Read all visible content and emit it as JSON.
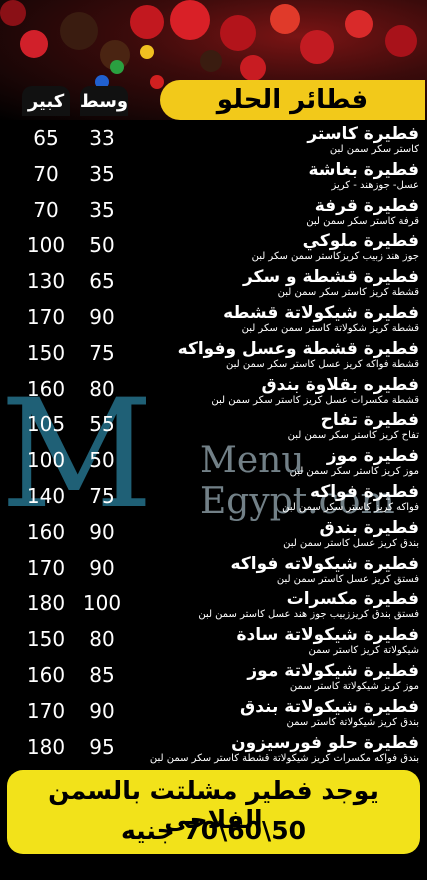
{
  "header": {
    "title": "فطائر الحلو",
    "col_large": "كبير",
    "col_medium": "وسط"
  },
  "watermark": {
    "logo_text": "Menu Egypt.com"
  },
  "items": [
    {
      "name": "فطيرة كاستر",
      "desc": "كاستر سكر سمن لبن",
      "medium": "33",
      "large": "65"
    },
    {
      "name": "فطيرة بغاشة",
      "desc": "عسل- جوزهند - كريز",
      "medium": "35",
      "large": "70"
    },
    {
      "name": "فطيرة قرفة",
      "desc": "قرفة كاستر سكر سمن لبن",
      "medium": "35",
      "large": "70"
    },
    {
      "name": "فطيرة ملوكي",
      "desc": "جوز هند زبيب كريزكاستر سمن سكر لبن",
      "medium": "50",
      "large": "100"
    },
    {
      "name": "فطيرة قشطة و سكر",
      "desc": "قشطة كريز كاستر سكر سمن لبن",
      "medium": "65",
      "large": "130"
    },
    {
      "name": "فطيرة شيكولاتة قشطه",
      "desc": "قشطة كريز شكولاتة كاستر سمن سكر لبن",
      "medium": "90",
      "large": "170"
    },
    {
      "name": "فطيرة قشطة وعسل وفواكه",
      "desc": "قشطة فواكه كريز عسل كاستر سكر سمن لبن",
      "medium": "75",
      "large": "150"
    },
    {
      "name": "فطيره بقلاوة بندق",
      "desc": "قشطة مكسرات عسل كريز كاستر سكر سمن لبن",
      "medium": "80",
      "large": "160"
    },
    {
      "name": "فطيرة تفاح",
      "desc": "تفاح كريز كاستر سكر سمن لبن",
      "medium": "55",
      "large": "105"
    },
    {
      "name": "فطيرة موز",
      "desc": "موز كريز كاستر سكر سمن لبن",
      "medium": "50",
      "large": "100"
    },
    {
      "name": "فطيرة فواكه",
      "desc": "فواكه كريز كاستر سكر سمن لبن",
      "medium": "75",
      "large": "140"
    },
    {
      "name": "فطيرة بندق",
      "desc": "بندق كريز عسل كاستر سمن لبن",
      "medium": "90",
      "large": "160"
    },
    {
      "name": "فطيرة شيكولاته فواكه",
      "desc": "فستق كريز عسل كاستر سمن لبن",
      "medium": "90",
      "large": "170"
    },
    {
      "name": "فطيرة مكسرات",
      "desc": "فستق بندق كريززبيب جوز هند عسل كاستر سمن لبن",
      "medium": "100",
      "large": "180"
    },
    {
      "name": "فطيرة شيكولاتة سادة",
      "desc": "شيكولاتة كريز كاستر سمن",
      "medium": "80",
      "large": "150"
    },
    {
      "name": "فطيرة شيكولاتة موز",
      "desc": "موز كريز شيكولاتة كاستر سمن",
      "medium": "85",
      "large": "160"
    },
    {
      "name": "فطيرة شيكولاتة بندق",
      "desc": "بندق كريز شيكولاتة كاستر سمن",
      "medium": "90",
      "large": "170"
    },
    {
      "name": "فطيرة حلو فورسيزون",
      "desc": "بندق فواكه مكسرات كريز شيكولاتة قشطة كاستر سكر سمن لبن",
      "medium": "95",
      "large": "180"
    }
  ],
  "footer": {
    "line1": "يوجد فطير مشلتت بالسمن الفلاحى",
    "line2": "50\\60\\70  جنيه"
  }
}
